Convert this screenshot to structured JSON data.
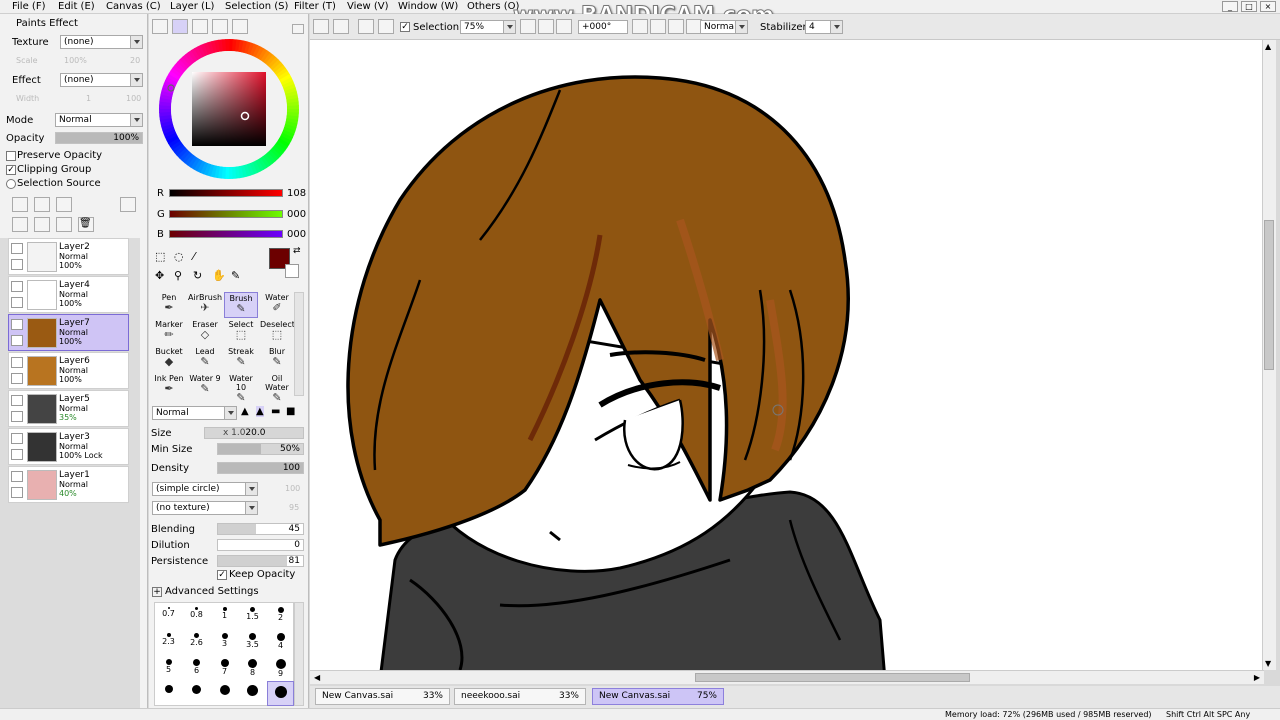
{
  "menu": [
    "File (F)",
    "Edit (E)",
    "Canvas (C)",
    "Layer (L)",
    "Selection (S)",
    "Filter (T)",
    "View (V)",
    "Window (W)",
    "Others (O)"
  ],
  "watermark": "www.BANDICAM.com",
  "toolbar": {
    "selection_label": "Selection",
    "zoom": "75%",
    "rotation": "+000°",
    "blend_mode": "Normal",
    "stabilizer_label": "Stabilizer",
    "stabilizer_value": "4"
  },
  "paints_effect": {
    "title": "Paints Effect",
    "texture_label": "Texture",
    "texture_value": "(none)",
    "scale_label": "Scale",
    "scale_value": "100%",
    "scale_num": "20",
    "effect_label": "Effect",
    "effect_value": "(none)",
    "width_label": "Width",
    "width_value": "1",
    "width_num": "100"
  },
  "layer_props": {
    "mode_label": "Mode",
    "mode_value": "Normal",
    "opacity_label": "Opacity",
    "opacity_value": "100%",
    "preserve_opacity": "Preserve Opacity",
    "clipping_group": "Clipping Group",
    "selection_source": "Selection Source"
  },
  "layers": [
    {
      "name": "Layer2",
      "mode": "Normal",
      "opacity": "100%",
      "thumb": "#f3f3f3",
      "selected": false
    },
    {
      "name": "Layer4",
      "mode": "Normal",
      "opacity": "100%",
      "thumb": "#ffffff",
      "selected": false
    },
    {
      "name": "Layer7",
      "mode": "Normal",
      "opacity": "100%",
      "thumb": "#9a5a12",
      "selected": true
    },
    {
      "name": "Layer6",
      "mode": "Normal",
      "opacity": "100%",
      "thumb": "#b87420",
      "selected": false
    },
    {
      "name": "Layer5",
      "mode": "Normal",
      "opacity": "35%",
      "thumb": "#444444",
      "selected": false
    },
    {
      "name": "Layer3",
      "mode": "Normal",
      "opacity": "100% Lock",
      "thumb": "#333333",
      "selected": false
    },
    {
      "name": "Layer1",
      "mode": "Normal",
      "opacity": "40%",
      "thumb": "#e8b0b0",
      "selected": false
    }
  ],
  "color": {
    "r_label": "R",
    "r_value": "108",
    "r": 108,
    "g_label": "G",
    "g_value": "000",
    "g": 0,
    "b_label": "B",
    "b_value": "000",
    "b": 0,
    "current": "#6c0000"
  },
  "tools": [
    {
      "label": "Pen",
      "active": false
    },
    {
      "label": "AirBrush",
      "active": false
    },
    {
      "label": "Brush",
      "active": true
    },
    {
      "label": "Water",
      "active": false
    },
    {
      "label": "Marker",
      "active": false
    },
    {
      "label": "Eraser",
      "active": false
    },
    {
      "label": "Select",
      "active": false
    },
    {
      "label": "Deselect",
      "active": false
    },
    {
      "label": "Bucket",
      "active": false
    },
    {
      "label": "Lead",
      "active": false
    },
    {
      "label": "Streak",
      "active": false
    },
    {
      "label": "Blur",
      "active": false
    },
    {
      "label": "Ink Pen",
      "active": false
    },
    {
      "label": "Water 9",
      "active": false
    },
    {
      "label": "Water 10",
      "active": false
    },
    {
      "label": "Oil Water",
      "active": false
    }
  ],
  "brush": {
    "blend_mode": "Normal",
    "size_label": "Size",
    "size_mult": "x 1.0",
    "size_value": "20.0",
    "minsize_label": "Min Size",
    "minsize_value": "50%",
    "minsize": 0.5,
    "density_label": "Density",
    "density_value": "100",
    "density": 1.0,
    "shape": "(simple circle)",
    "shape_num": "100",
    "texture": "(no texture)",
    "texture_num": "95",
    "blending_label": "Blending",
    "blending_value": "45",
    "blending": 0.45,
    "dilution_label": "Dilution",
    "dilution_value": "0",
    "dilution": 0.0,
    "persistence_label": "Persistence",
    "persistence_value": "81",
    "persistence": 0.81,
    "keep_opacity": "Keep Opacity",
    "advanced": "Advanced Settings"
  },
  "brush_sizes": [
    "0.7",
    "0.8",
    "1",
    "1.5",
    "2",
    "2.3",
    "2.6",
    "3",
    "3.5",
    "4",
    "5",
    "6",
    "7",
    "8",
    "9",
    "",
    "",
    "",
    "",
    ""
  ],
  "tabs": [
    {
      "name": "New Canvas.sai",
      "zoom": "33%",
      "active": false
    },
    {
      "name": "neeekooo.sai",
      "zoom": "33%",
      "active": false
    },
    {
      "name": "New Canvas.sai",
      "zoom": "75%",
      "active": true
    }
  ],
  "status": "Memory load: 72% (296MB used / 985MB reserved)",
  "status_keys": "Shift Ctrl Alt SPC Any"
}
